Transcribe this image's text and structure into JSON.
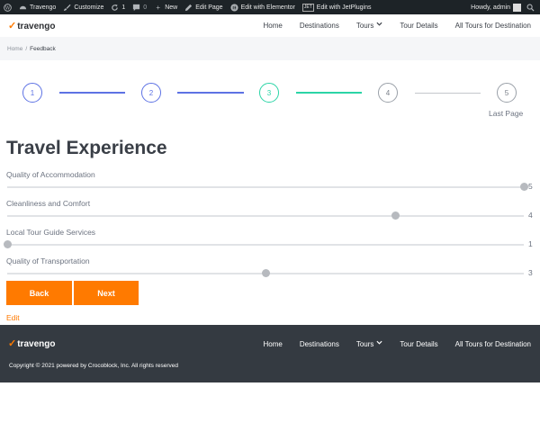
{
  "adminbar": {
    "site_name": "Travengo",
    "customize": "Customize",
    "updates_count": "1",
    "comments_count": "0",
    "new_label": "New",
    "edit_page": "Edit Page",
    "elementor": "Edit with Elementor",
    "jet_badge": "JET",
    "jetplugins": "Edit with JetPlugins",
    "howdy": "Howdy, admin"
  },
  "brand": {
    "name": "travengo",
    "accent": "#ff7a00"
  },
  "nav": {
    "home": "Home",
    "destinations": "Destinations",
    "tours": "Tours",
    "tour_details": "Tour Details",
    "all_tours": "All Tours for Destination"
  },
  "breadcrumb": {
    "home": "Home",
    "sep": "/",
    "current": "Feedback"
  },
  "stepper": {
    "steps": [
      "1",
      "2",
      "3",
      "4",
      "5"
    ],
    "current": 3,
    "last_label": "Last Page",
    "colors": {
      "done": "#5d72e4",
      "active": "#2bd4a6",
      "todo": "#c4c7cc"
    }
  },
  "form": {
    "title": "Travel Experience",
    "scale_max": 5,
    "scale_min": 1,
    "questions": [
      {
        "label": "Quality of Accommodation",
        "value": "5"
      },
      {
        "label": "Cleanliness and Comfort",
        "value": "4"
      },
      {
        "label": "Local Tour Guide Services",
        "value": "1"
      },
      {
        "label": "Quality of Transportation",
        "value": "3"
      }
    ],
    "back_label": "Back",
    "next_label": "Next",
    "edit_label": "Edit"
  },
  "footer": {
    "copyright": "Copyright © 2021 powered by Crocoblock, Inc. All rights reserved"
  }
}
